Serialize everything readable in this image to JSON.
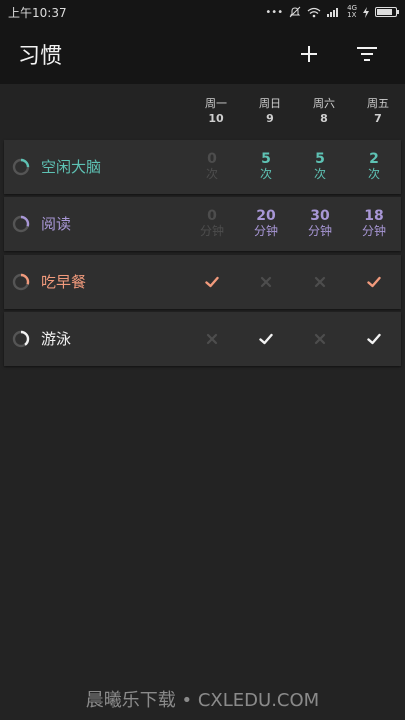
{
  "statusbar": {
    "time": "上午10:37",
    "network": "4G",
    "network_sub": "1X"
  },
  "appbar": {
    "title": "习惯"
  },
  "colors": {
    "teal": "#5ec2b4",
    "purple": "#a897d6",
    "orange": "#f19a7c",
    "white": "#f2f2f2",
    "dim": "#4d4d4d",
    "unit_dim": "#6a6a6a"
  },
  "days": [
    {
      "name": "周一",
      "num": "10"
    },
    {
      "name": "周日",
      "num": "9"
    },
    {
      "name": "周六",
      "num": "8"
    },
    {
      "name": "周五",
      "num": "7"
    }
  ],
  "habits": [
    {
      "name": "空闲大脑",
      "color": "#5ec2b4",
      "progress": 0.25,
      "kind": "count",
      "cells": [
        {
          "value": "0",
          "unit": "次",
          "active": false
        },
        {
          "value": "5",
          "unit": "次",
          "active": true
        },
        {
          "value": "5",
          "unit": "次",
          "active": true
        },
        {
          "value": "2",
          "unit": "次",
          "active": true
        }
      ]
    },
    {
      "name": "阅读",
      "color": "#a897d6",
      "progress": 0.3,
      "kind": "count",
      "cells": [
        {
          "value": "0",
          "unit": "分钟",
          "active": false
        },
        {
          "value": "20",
          "unit": "分钟",
          "active": true
        },
        {
          "value": "30",
          "unit": "分钟",
          "active": true
        },
        {
          "value": "18",
          "unit": "分钟",
          "active": true
        }
      ]
    },
    {
      "name": "吃早餐",
      "color": "#f19a7c",
      "progress": 0.3,
      "kind": "check",
      "cells": [
        {
          "state": "check"
        },
        {
          "state": "cross"
        },
        {
          "state": "cross"
        },
        {
          "state": "check"
        }
      ]
    },
    {
      "name": "游泳",
      "color": "#f2f2f2",
      "progress": 0.4,
      "kind": "check",
      "cells": [
        {
          "state": "cross"
        },
        {
          "state": "check"
        },
        {
          "state": "cross"
        },
        {
          "state": "check"
        }
      ]
    }
  ],
  "watermark": "晨曦乐下载 • CXLEDU.COM"
}
